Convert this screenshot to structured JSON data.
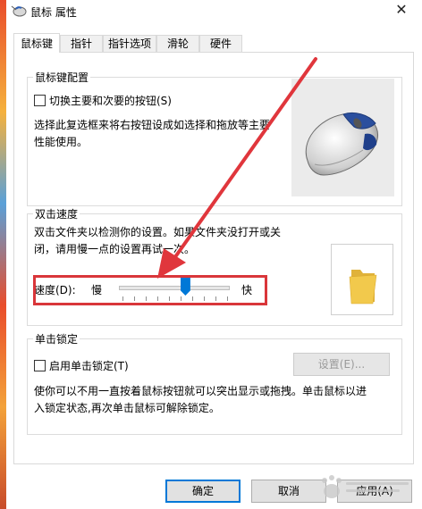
{
  "window": {
    "title": "鼠标 属性",
    "close_glyph": "✕"
  },
  "tabs": [
    {
      "label": "鼠标键"
    },
    {
      "label": "指针"
    },
    {
      "label": "指针选项"
    },
    {
      "label": "滑轮"
    },
    {
      "label": "硬件"
    }
  ],
  "button_config": {
    "title": "鼠标键配置",
    "swap_checkbox_label": "切换主要和次要的按钮(S)",
    "swap_checked": false,
    "description_line1": "选择此复选框来将右按钮设成如选择和拖放等主要",
    "description_line2": "性能使用。"
  },
  "double_click": {
    "title": "双击速度",
    "description_line1": "双击文件夹以检测你的设置。如果文件夹没打开或关",
    "description_line2": "闭，请用慢一点的设置再试一次。",
    "speed_label": "速度(D):",
    "slow_label": "慢",
    "fast_label": "快",
    "speed_level": 0.6
  },
  "click_lock": {
    "title": "单击锁定",
    "checkbox_label": "启用单击锁定(T)",
    "checked": false,
    "settings_button": "设置(E)...",
    "description_line1": "使你可以不用一直按着鼠标按钮就可以突出显示或拖拽。单击鼠标以进",
    "description_line2": "入锁定状态,再次单击鼠标可解除锁定。"
  },
  "footer": {
    "ok": "确定",
    "cancel": "取消",
    "apply": "应用(A)"
  },
  "colors": {
    "accent": "#0078d7",
    "highlight_red": "#d9363a",
    "folder": "#f2c94c"
  }
}
